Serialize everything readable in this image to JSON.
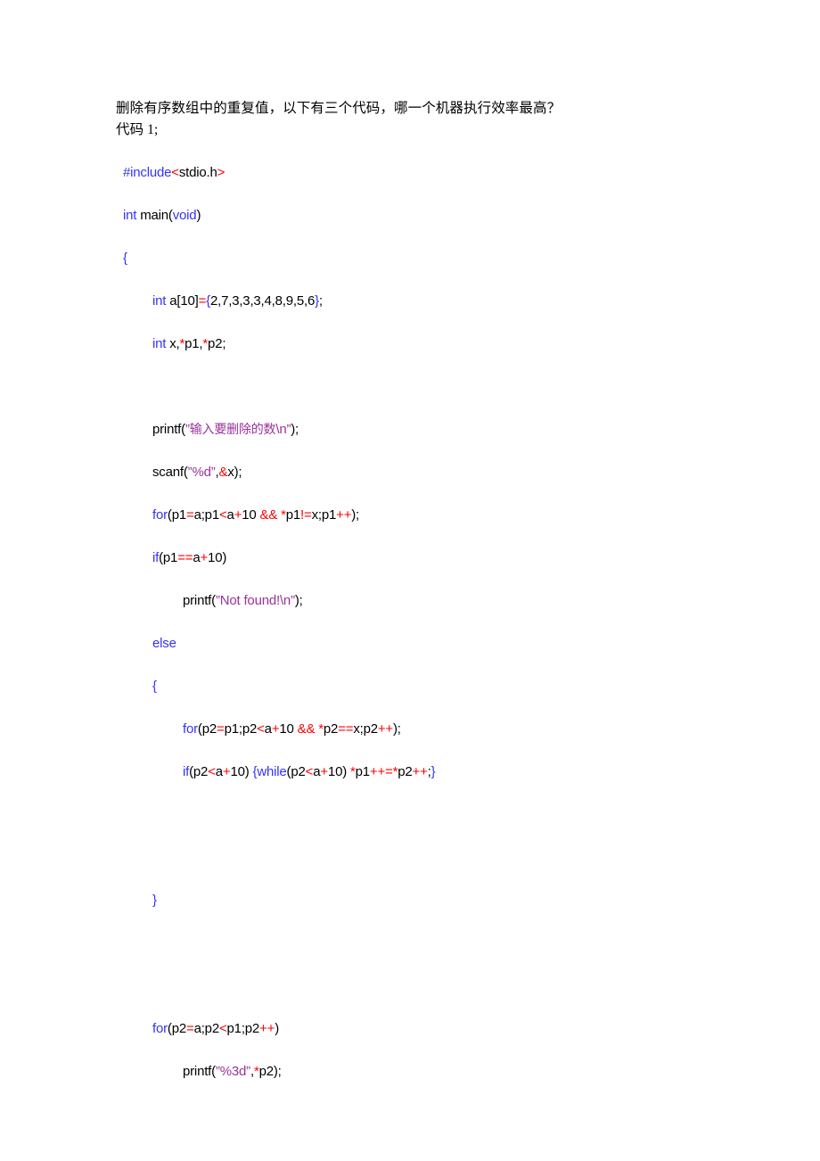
{
  "document": {
    "title": "删除有序数组中的重复值",
    "background_color": "#ffffff"
  },
  "colors": {
    "keyword": "#3333ff",
    "operator": "#ff0000",
    "brace": "#3333ff",
    "string": "#993399",
    "plain": "#000000",
    "page_background": "#ffffff"
  },
  "prose": {
    "line1": "删除有序数组中的重复值，以下有三个代码，哪一个机器执行效率最高？",
    "line2": "代码 1;"
  },
  "code": {
    "language": "c",
    "lines": [
      {
        "id": "line-include",
        "indent": 0,
        "tokens": [
          {
            "t": "#include",
            "c": "kw"
          },
          {
            "t": "<",
            "c": "op"
          },
          {
            "t": "stdio.h",
            "c": "pl"
          },
          {
            "t": ">",
            "c": "op"
          }
        ]
      },
      {
        "id": "line-main",
        "indent": 0,
        "tokens": [
          {
            "t": "int",
            "c": "kw"
          },
          {
            "t": " main(",
            "c": "pl"
          },
          {
            "t": "void",
            "c": "kw"
          },
          {
            "t": ")",
            "c": "pl"
          }
        ]
      },
      {
        "id": "line-open-brace",
        "indent": 0,
        "tokens": [
          {
            "t": "{",
            "c": "br"
          }
        ]
      },
      {
        "id": "line-array-decl",
        "indent": 1,
        "tokens": [
          {
            "t": "int",
            "c": "kw"
          },
          {
            "t": " a[10]",
            "c": "pl"
          },
          {
            "t": "=",
            "c": "op"
          },
          {
            "t": "{",
            "c": "br"
          },
          {
            "t": "2,7,3,3,3,4,8,9,5,6",
            "c": "pl"
          },
          {
            "t": "}",
            "c": "br"
          },
          {
            "t": ";",
            "c": "pl"
          }
        ]
      },
      {
        "id": "line-var-decl",
        "indent": 1,
        "tokens": [
          {
            "t": "int",
            "c": "kw"
          },
          {
            "t": " x,",
            "c": "pl"
          },
          {
            "t": "*",
            "c": "op"
          },
          {
            "t": "p1,",
            "c": "pl"
          },
          {
            "t": "*",
            "c": "op"
          },
          {
            "t": "p2;",
            "c": "pl"
          }
        ]
      },
      {
        "id": "line-blank-1",
        "indent": 0,
        "tokens": []
      },
      {
        "id": "line-printf-prompt",
        "indent": 1,
        "tokens": [
          {
            "t": "printf(",
            "c": "pl"
          },
          {
            "t": "”",
            "c": "str"
          },
          {
            "t": "输入要删除的数",
            "c": "strcn"
          },
          {
            "t": "\\n”",
            "c": "str"
          },
          {
            "t": ");",
            "c": "pl"
          }
        ]
      },
      {
        "id": "line-scanf",
        "indent": 1,
        "tokens": [
          {
            "t": "scanf(",
            "c": "pl"
          },
          {
            "t": "”%d”",
            "c": "str"
          },
          {
            "t": ",",
            "c": "pl"
          },
          {
            "t": "&",
            "c": "op"
          },
          {
            "t": "x);",
            "c": "pl"
          }
        ]
      },
      {
        "id": "line-for-find",
        "indent": 1,
        "tokens": [
          {
            "t": "for",
            "c": "kw"
          },
          {
            "t": "(p1",
            "c": "pl"
          },
          {
            "t": "=",
            "c": "op"
          },
          {
            "t": "a;p1",
            "c": "pl"
          },
          {
            "t": "<",
            "c": "op"
          },
          {
            "t": "a",
            "c": "pl"
          },
          {
            "t": "+",
            "c": "op"
          },
          {
            "t": "10 ",
            "c": "pl"
          },
          {
            "t": "&&",
            "c": "op"
          },
          {
            "t": " ",
            "c": "pl"
          },
          {
            "t": "*",
            "c": "op"
          },
          {
            "t": "p1",
            "c": "pl"
          },
          {
            "t": "!=",
            "c": "op"
          },
          {
            "t": "x;p1",
            "c": "pl"
          },
          {
            "t": "++",
            "c": "op"
          },
          {
            "t": ");",
            "c": "pl"
          }
        ]
      },
      {
        "id": "line-if-notfound",
        "indent": 1,
        "tokens": [
          {
            "t": "if",
            "c": "kw"
          },
          {
            "t": "(p1",
            "c": "pl"
          },
          {
            "t": "==",
            "c": "op"
          },
          {
            "t": "a",
            "c": "pl"
          },
          {
            "t": "+",
            "c": "op"
          },
          {
            "t": "10)",
            "c": "pl"
          }
        ]
      },
      {
        "id": "line-printf-notfound",
        "indent": 2,
        "tokens": [
          {
            "t": "printf(",
            "c": "pl"
          },
          {
            "t": "”Not found!\\n”",
            "c": "str"
          },
          {
            "t": ");",
            "c": "pl"
          }
        ]
      },
      {
        "id": "line-else",
        "indent": 1,
        "tokens": [
          {
            "t": "else",
            "c": "kw"
          }
        ]
      },
      {
        "id": "line-inner-open-brace",
        "indent": 1,
        "tokens": [
          {
            "t": "{",
            "c": "br"
          }
        ]
      },
      {
        "id": "line-for-skip",
        "indent": 2,
        "tokens": [
          {
            "t": "for",
            "c": "kw"
          },
          {
            "t": "(p2",
            "c": "pl"
          },
          {
            "t": "=",
            "c": "op"
          },
          {
            "t": "p1;p2",
            "c": "pl"
          },
          {
            "t": "<",
            "c": "op"
          },
          {
            "t": "a",
            "c": "pl"
          },
          {
            "t": "+",
            "c": "op"
          },
          {
            "t": "10 ",
            "c": "pl"
          },
          {
            "t": "&&",
            "c": "op"
          },
          {
            "t": " ",
            "c": "pl"
          },
          {
            "t": "*",
            "c": "op"
          },
          {
            "t": "p2",
            "c": "pl"
          },
          {
            "t": "==",
            "c": "op"
          },
          {
            "t": "x;p2",
            "c": "pl"
          },
          {
            "t": "++",
            "c": "op"
          },
          {
            "t": ");",
            "c": "pl"
          }
        ]
      },
      {
        "id": "line-if-while-shift",
        "indent": 2,
        "tokens": [
          {
            "t": "if",
            "c": "kw"
          },
          {
            "t": "(p2",
            "c": "pl"
          },
          {
            "t": "<",
            "c": "op"
          },
          {
            "t": "a",
            "c": "pl"
          },
          {
            "t": "+",
            "c": "op"
          },
          {
            "t": "10) ",
            "c": "pl"
          },
          {
            "t": "{",
            "c": "br"
          },
          {
            "t": "while",
            "c": "kw"
          },
          {
            "t": "(p2",
            "c": "pl"
          },
          {
            "t": "<",
            "c": "op"
          },
          {
            "t": "a",
            "c": "pl"
          },
          {
            "t": "+",
            "c": "op"
          },
          {
            "t": "10) ",
            "c": "pl"
          },
          {
            "t": "*",
            "c": "op"
          },
          {
            "t": "p1",
            "c": "pl"
          },
          {
            "t": "++=",
            "c": "op"
          },
          {
            "t": "*",
            "c": "op"
          },
          {
            "t": "p2",
            "c": "pl"
          },
          {
            "t": "++",
            "c": "op"
          },
          {
            "t": ";",
            "c": "pl"
          },
          {
            "t": "}",
            "c": "br"
          }
        ]
      },
      {
        "id": "line-blank-2",
        "indent": 0,
        "tokens": []
      },
      {
        "id": "line-blank-3",
        "indent": 0,
        "tokens": []
      },
      {
        "id": "line-inner-close-brace",
        "indent": 1,
        "tokens": [
          {
            "t": "}",
            "c": "br"
          }
        ]
      },
      {
        "id": "line-blank-4",
        "indent": 0,
        "tokens": []
      },
      {
        "id": "line-blank-5",
        "indent": 0,
        "tokens": []
      },
      {
        "id": "line-for-print",
        "indent": 1,
        "tokens": [
          {
            "t": "for",
            "c": "kw"
          },
          {
            "t": "(p2",
            "c": "pl"
          },
          {
            "t": "=",
            "c": "op"
          },
          {
            "t": "a;p2",
            "c": "pl"
          },
          {
            "t": "<",
            "c": "op"
          },
          {
            "t": "p1;p2",
            "c": "pl"
          },
          {
            "t": "++",
            "c": "op"
          },
          {
            "t": ")",
            "c": "pl"
          }
        ]
      },
      {
        "id": "line-printf-result",
        "indent": 2,
        "tokens": [
          {
            "t": "printf(",
            "c": "pl"
          },
          {
            "t": "”%3d”",
            "c": "str"
          },
          {
            "t": ",",
            "c": "pl"
          },
          {
            "t": "*",
            "c": "op"
          },
          {
            "t": "p2);",
            "c": "pl"
          }
        ]
      }
    ]
  }
}
